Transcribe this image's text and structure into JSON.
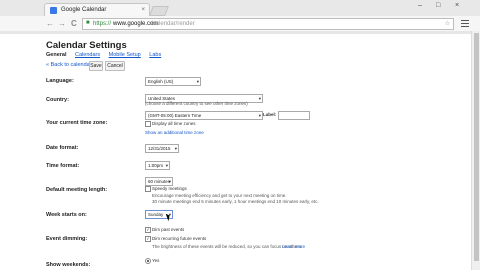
{
  "browser": {
    "tab_title": "Google Calendar",
    "tab_close": "×",
    "window_controls": {
      "minimize": "–",
      "maximize": "□",
      "close": "×"
    },
    "nav": {
      "back": "←",
      "forward": "→",
      "reload": "C"
    },
    "url_protocol": "https://",
    "url_host": "www.google.com",
    "url_path": "/calendar/render",
    "star": "☆"
  },
  "page": {
    "title": "Calendar Settings",
    "tabs": [
      {
        "label": "General",
        "active": true
      },
      {
        "label": "Calendars",
        "active": false
      },
      {
        "label": "Mobile Setup",
        "active": false
      },
      {
        "label": "Labs",
        "active": false
      }
    ],
    "back_link": "« Back to calendar",
    "save_button": "Save",
    "cancel_button": "Cancel"
  },
  "settings": {
    "language": {
      "label": "Language:",
      "value": "English (US)"
    },
    "country": {
      "label": "Country:",
      "value": "United States",
      "note": "(choose a different country to see other time zones)"
    },
    "timezone": {
      "label": "Your current time zone:",
      "value": "(GMT-05:00) Eastern Time",
      "label_field": "Label:",
      "display_all": "Display all time zones",
      "show_alt": "Show an additional time zone"
    },
    "date_format": {
      "label": "Date format:",
      "value": "12/31/2015"
    },
    "time_format": {
      "label": "Time format:",
      "value": "1:00pm"
    },
    "meeting_length": {
      "label": "Default meeting length:",
      "value": "60 minutes",
      "speedy": "Speedy meetings",
      "note_line1": "Encourage meeting efficiency and get to your next meeting on time.",
      "note_line2": "30 minute meetings end 5 minutes early, 1 hour meetings end 10 minutes early, etc."
    },
    "week_start": {
      "label": "Week starts on:",
      "value": "Sunday"
    },
    "event_dimming": {
      "label": "Event dimming:",
      "option1": "Dim past events",
      "option2": "Dim recurring future events",
      "note": "The brightness of these events will be reduced, so you can focus on others.",
      "learn_more": "Learn more"
    },
    "weekends": {
      "label": "Show weekends:",
      "value": "Yes"
    }
  },
  "colors": {
    "link": "#1155cc",
    "favicon": "#3b78e7",
    "secure": "#2e8b3a"
  }
}
